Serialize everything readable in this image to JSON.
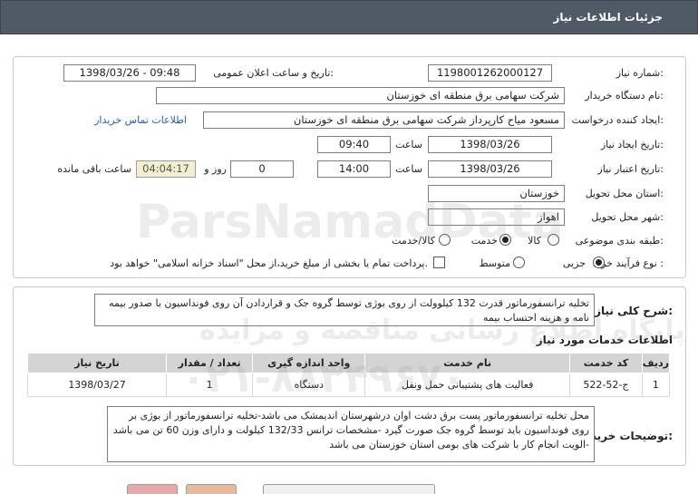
{
  "header": {
    "title": "جزئیات اطلاعات نیاز"
  },
  "fields": {
    "need_number_label": "شماره نیاز:",
    "need_number": "1198001262000127",
    "announce_label": "تاریخ و ساعت اعلان عمومی:",
    "announce_value": "1398/03/26 - 09:48",
    "buyer_org_label": "نام دستگاه خریدار:",
    "buyer_org": "شرکت سهامی برق منطقه ای خوزستان",
    "requester_label": "ایجاد کننده درخواست:",
    "requester": "مسعود میاح کارپرداز شرکت سهامی برق منطقه ای خوزستان",
    "contact_link": "اطلاعات تماس خریدار",
    "create_date_label": "تاریخ ایجاد نیاز:",
    "create_date": "1398/03/26",
    "time_label": "ساعت",
    "create_time": "09:40",
    "validity_label": "تاریخ اعتبار نیاز:",
    "validity_date": "1398/03/26",
    "validity_time": "14:00",
    "days_value": "0",
    "days_label": "روز و",
    "remaining_time": "04:04:17",
    "remaining_label": "ساعت باقی مانده",
    "province_label": "استان محل تحویل:",
    "province": "خوزستان",
    "city_label": "شهر محل تحویل:",
    "city": "اهواز",
    "category_label": "طبقه بندی موضوعی:",
    "category_options": [
      "کالا",
      "خدمت",
      "کالا/خدمت"
    ],
    "category_selected": "خدمت",
    "process_label": "نوع فرآیند خرید :",
    "process_options": [
      "جزیی",
      "متوسط"
    ],
    "process_selected": "جزیی",
    "payment_note": "پرداخت تمام یا بخشی از مبلغ خرید،از محل \"اسناد خزانه اسلامی\" خواهد بود."
  },
  "summary": {
    "label": "شرح کلی نیاز:",
    "text": "تخلیه ترانسفورماتور قدرت 132 کیلوولت از روی بوژی توسط گروه جک و قراردادن آن روی فونداسیون با صدور بیمه نامه و هزینه احتساب بیمه"
  },
  "services": {
    "title": "اطلاعات خدمات مورد نیاز",
    "columns": [
      "ردیف",
      "کد خدمت",
      "نام خدمت",
      "واحد اندازه گیری",
      "تعداد / مقدار",
      "تاریخ نیاز"
    ],
    "rows": [
      [
        "1",
        "ج-52-522",
        "فعالیت های پشتیبانی حمل ونقل",
        "دستگاه",
        "1",
        "1398/03/27"
      ]
    ]
  },
  "description": {
    "label": "توضیحات خریدار:",
    "text": "محل تخلیه ترانسفورماتور پست برق دشت اوان درشهرستان اندیمشک می باشد-تخلیه ترانسفورماتور از بوژی بر روی فونداسیون باید توسط گروه جک صورت گیرد -مشخصات ترانس 132/33 کیلولت و دارای وزن 60 تن می باشد -الویت انجام کار با شرکت های بومی استان خوزستان می باشد"
  },
  "watermark": {
    "brand": "ParsNamadData",
    "line1": "پایگاه اطلاع رسانی مناقصه و مزایده",
    "phone": "۰۲۱-۸۸۳۴۹۶۷۰"
  },
  "colors": {
    "header_bg": "#4f5a66",
    "remaining_bg": "#f6efcf",
    "link": "#1f5fbf"
  }
}
